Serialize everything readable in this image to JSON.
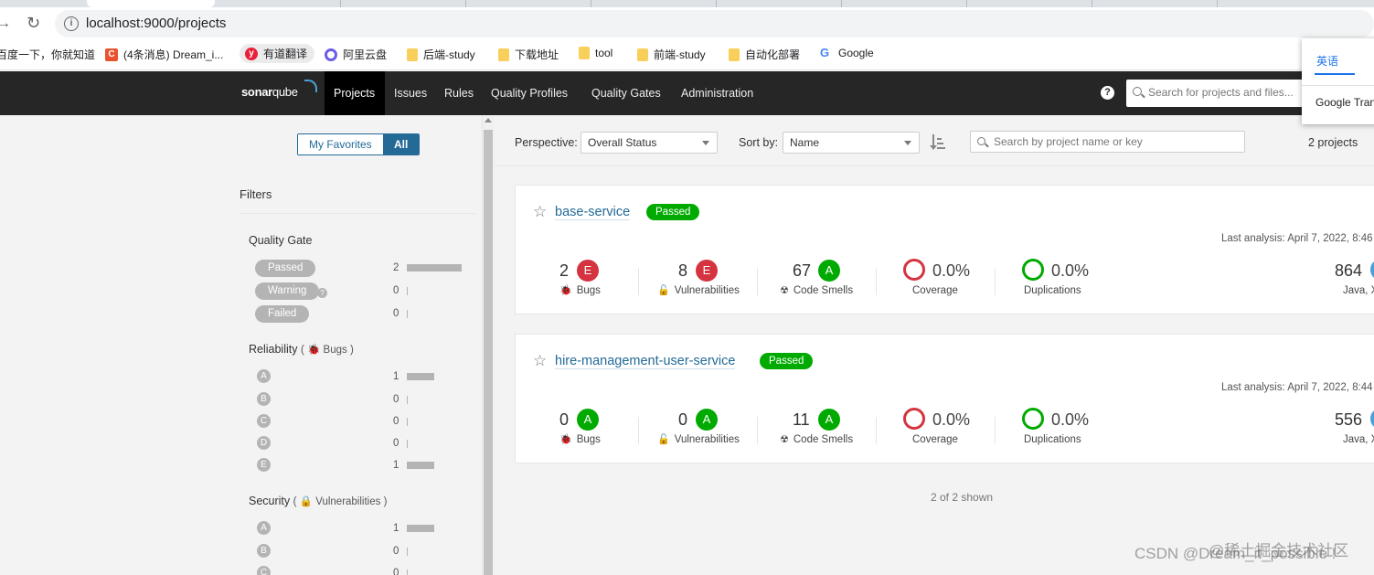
{
  "browser": {
    "url": "localhost:9000/projects",
    "bookmarks": [
      {
        "label": "百度一下，你就知道",
        "icon": "baidu-icon"
      },
      {
        "label": "(4条消息) Dream_i...",
        "icon": "csdn-icon"
      },
      {
        "label": "有道翻译",
        "icon": "youdao-icon"
      },
      {
        "label": "阿里云盘",
        "icon": "aliyun-icon"
      },
      {
        "label": "后端-study",
        "icon": "folder-icon"
      },
      {
        "label": "下载地址",
        "icon": "folder-icon"
      },
      {
        "label": "tool",
        "icon": "folder-icon"
      },
      {
        "label": "前端-study",
        "icon": "folder-icon"
      },
      {
        "label": "自动化部署",
        "icon": "folder-icon"
      },
      {
        "label": "Google",
        "icon": "google-icon"
      }
    ],
    "translate": {
      "language": "英语",
      "service": "Google Tran"
    }
  },
  "nav": {
    "brand": {
      "bold": "sonar",
      "light": "qube"
    },
    "items": [
      "Projects",
      "Issues",
      "Rules",
      "Quality Profiles",
      "Quality Gates",
      "Administration"
    ],
    "search_placeholder": "Search for projects and files..."
  },
  "sidebar": {
    "toggle": {
      "favorites": "My Favorites",
      "all": "All"
    },
    "filters_title": "Filters",
    "quality_gate": {
      "title": "Quality Gate",
      "options": [
        {
          "label": "Passed",
          "count": "2"
        },
        {
          "label": "Warning",
          "count": "0"
        },
        {
          "label": "Failed",
          "count": "0"
        }
      ]
    },
    "reliability": {
      "title": "Reliability",
      "sub": "Bugs",
      "ratings": [
        {
          "label": "A",
          "count": "1"
        },
        {
          "label": "B",
          "count": "0"
        },
        {
          "label": "C",
          "count": "0"
        },
        {
          "label": "D",
          "count": "0"
        },
        {
          "label": "E",
          "count": "1"
        }
      ]
    },
    "security": {
      "title": "Security",
      "sub": "Vulnerabilities",
      "ratings": [
        {
          "label": "A",
          "count": "1"
        },
        {
          "label": "B",
          "count": "0"
        },
        {
          "label": "C",
          "count": "0"
        }
      ]
    }
  },
  "toolbar": {
    "perspective_label": "Perspective:",
    "perspective_value": "Overall Status",
    "sort_label": "Sort by:",
    "sort_value": "Name",
    "search_placeholder": "Search by project name or key",
    "count": "2 projects"
  },
  "projects": [
    {
      "name": "base-service",
      "status": "Passed",
      "last_analysis": "Last analysis: April 7, 2022, 8:46",
      "bugs": "2",
      "bugs_rating": "E",
      "vulns": "8",
      "vulns_rating": "E",
      "smells": "67",
      "smells_rating": "A",
      "coverage": "0.0%",
      "duplications": "0.0%",
      "loc": "864",
      "langs": "Java, X"
    },
    {
      "name": "hire-management-user-service",
      "status": "Passed",
      "last_analysis": "Last analysis: April 7, 2022, 8:44",
      "bugs": "0",
      "bugs_rating": "A",
      "vulns": "0",
      "vulns_rating": "A",
      "smells": "11",
      "smells_rating": "A",
      "coverage": "0.0%",
      "duplications": "0.0%",
      "loc": "556",
      "langs": "Java, X"
    }
  ],
  "metric_labels": {
    "bugs": "Bugs",
    "vulns": "Vulnerabilities",
    "smells": "Code Smells",
    "coverage": "Coverage",
    "duplications": "Duplications"
  },
  "footer": {
    "shown": "2 of 2 shown"
  },
  "watermark": "CSDN @Dream_it_possible !",
  "watermark_overlay": "@稀土掘金技术社区",
  "colors": {
    "nav_bg": "#262626",
    "link": "#236a97",
    "passed": "#00aa00",
    "rating_e": "#d4333f",
    "rating_a": "#00aa00"
  }
}
